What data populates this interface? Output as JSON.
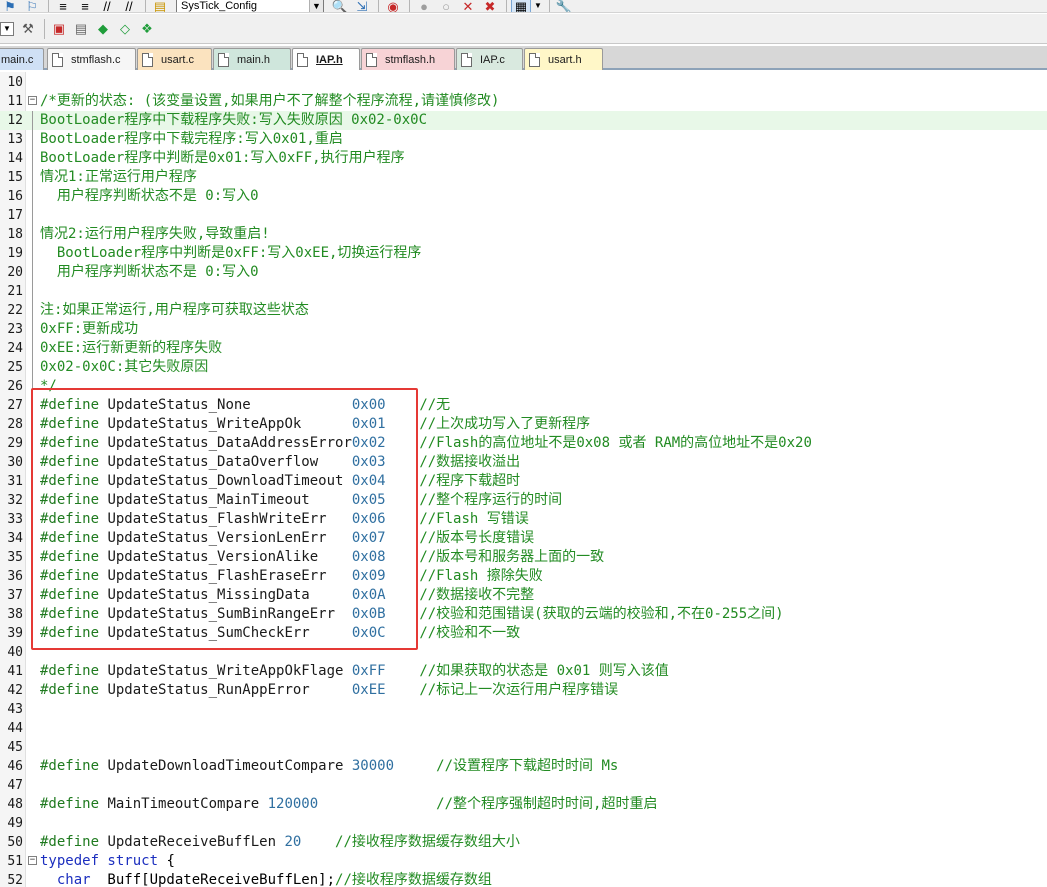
{
  "toolbar1": {
    "combo_value": "SysTick_Config"
  },
  "tabs": [
    {
      "label": "main.c",
      "color": "#cfe0f5",
      "active": false
    },
    {
      "label": "stmflash.c",
      "color": "#f6f6f6",
      "active": false
    },
    {
      "label": "usart.c",
      "color": "#fbe3bf",
      "active": false
    },
    {
      "label": "main.h",
      "color": "#cfe6dc",
      "active": false
    },
    {
      "label": "IAP.h",
      "color": "#ffffff",
      "active": true
    },
    {
      "label": "stmflash.h",
      "color": "#f7d3d6",
      "active": false
    },
    {
      "label": "IAP.c",
      "color": "#d9e9df",
      "active": false
    },
    {
      "label": "usart.h",
      "color": "#fff7c8",
      "active": false
    }
  ],
  "editor": {
    "lines": [
      {
        "num": "10",
        "fold": "",
        "segs": []
      },
      {
        "num": "11",
        "fold": "-",
        "segs": [
          {
            "t": "/*更新的状态: (该变量设置,如果用户不了解整个程序流程,请谨慎修改)",
            "c": "cm"
          }
        ]
      },
      {
        "num": "12",
        "fold": "",
        "hl": true,
        "segs": [
          {
            "t": "BootLoader程序中下载程序失败:写入失败原因 0x02-0x0C",
            "c": "cm"
          }
        ]
      },
      {
        "num": "13",
        "fold": "",
        "segs": [
          {
            "t": "BootLoader程序中下载完程序:写入0x01,重启",
            "c": "cm"
          }
        ]
      },
      {
        "num": "14",
        "fold": "",
        "segs": [
          {
            "t": "BootLoader程序中判断是0x01:写入0xFF,执行用户程序",
            "c": "cm"
          }
        ]
      },
      {
        "num": "15",
        "fold": "",
        "segs": [
          {
            "t": "情况1:正常运行用户程序",
            "c": "cm"
          }
        ]
      },
      {
        "num": "16",
        "fold": "",
        "segs": [
          {
            "t": "  用户程序判断状态不是 0:写入0",
            "c": "cm"
          }
        ]
      },
      {
        "num": "17",
        "fold": "",
        "segs": []
      },
      {
        "num": "18",
        "fold": "",
        "segs": [
          {
            "t": "情况2:运行用户程序失败,导致重启!",
            "c": "cm"
          }
        ]
      },
      {
        "num": "19",
        "fold": "",
        "segs": [
          {
            "t": "  BootLoader程序中判断是0xFF:写入0xEE,切换运行程序",
            "c": "cm"
          }
        ]
      },
      {
        "num": "20",
        "fold": "",
        "segs": [
          {
            "t": "  用户程序判断状态不是 0:写入0",
            "c": "cm"
          }
        ]
      },
      {
        "num": "21",
        "fold": "",
        "segs": []
      },
      {
        "num": "22",
        "fold": "",
        "segs": [
          {
            "t": "注:如果正常运行,用户程序可获取这些状态",
            "c": "cm"
          }
        ]
      },
      {
        "num": "23",
        "fold": "",
        "segs": [
          {
            "t": "0xFF:更新成功",
            "c": "cm"
          }
        ]
      },
      {
        "num": "24",
        "fold": "",
        "segs": [
          {
            "t": "0xEE:运行新更新的程序失败",
            "c": "cm"
          }
        ]
      },
      {
        "num": "25",
        "fold": "",
        "segs": [
          {
            "t": "0x02-0x0C:其它失败原因",
            "c": "cm"
          }
        ]
      },
      {
        "num": "26",
        "fold": "",
        "segs": [
          {
            "t": "*/",
            "c": "cm"
          }
        ]
      },
      {
        "num": "27",
        "fold": "",
        "segs": [
          {
            "t": "#define ",
            "c": "pp"
          },
          {
            "t": "UpdateStatus_None            ",
            "c": "id"
          },
          {
            "t": "0x00    ",
            "c": "num"
          },
          {
            "t": "//无",
            "c": "cm"
          }
        ]
      },
      {
        "num": "28",
        "fold": "",
        "segs": [
          {
            "t": "#define ",
            "c": "pp"
          },
          {
            "t": "UpdateStatus_WriteAppOk      ",
            "c": "id"
          },
          {
            "t": "0x01    ",
            "c": "num"
          },
          {
            "t": "//上次成功写入了更新程序",
            "c": "cm"
          }
        ]
      },
      {
        "num": "29",
        "fold": "",
        "segs": [
          {
            "t": "#define ",
            "c": "pp"
          },
          {
            "t": "UpdateStatus_DataAddressError",
            "c": "id"
          },
          {
            "t": "0x02    ",
            "c": "num"
          },
          {
            "t": "//Flash的高位地址不是0x08 或者 RAM的高位地址不是0x20",
            "c": "cm"
          }
        ]
      },
      {
        "num": "30",
        "fold": "",
        "segs": [
          {
            "t": "#define ",
            "c": "pp"
          },
          {
            "t": "UpdateStatus_DataOverflow    ",
            "c": "id"
          },
          {
            "t": "0x03    ",
            "c": "num"
          },
          {
            "t": "//数据接收溢出",
            "c": "cm"
          }
        ]
      },
      {
        "num": "31",
        "fold": "",
        "segs": [
          {
            "t": "#define ",
            "c": "pp"
          },
          {
            "t": "UpdateStatus_DownloadTimeout ",
            "c": "id"
          },
          {
            "t": "0x04    ",
            "c": "num"
          },
          {
            "t": "//程序下载超时",
            "c": "cm"
          }
        ]
      },
      {
        "num": "32",
        "fold": "",
        "segs": [
          {
            "t": "#define ",
            "c": "pp"
          },
          {
            "t": "UpdateStatus_MainTimeout     ",
            "c": "id"
          },
          {
            "t": "0x05    ",
            "c": "num"
          },
          {
            "t": "//整个程序运行的时间",
            "c": "cm"
          }
        ]
      },
      {
        "num": "33",
        "fold": "",
        "segs": [
          {
            "t": "#define ",
            "c": "pp"
          },
          {
            "t": "UpdateStatus_FlashWriteErr   ",
            "c": "id"
          },
          {
            "t": "0x06    ",
            "c": "num"
          },
          {
            "t": "//Flash 写错误",
            "c": "cm"
          }
        ]
      },
      {
        "num": "34",
        "fold": "",
        "segs": [
          {
            "t": "#define ",
            "c": "pp"
          },
          {
            "t": "UpdateStatus_VersionLenErr   ",
            "c": "id"
          },
          {
            "t": "0x07    ",
            "c": "num"
          },
          {
            "t": "//版本号长度错误",
            "c": "cm"
          }
        ]
      },
      {
        "num": "35",
        "fold": "",
        "segs": [
          {
            "t": "#define ",
            "c": "pp"
          },
          {
            "t": "UpdateStatus_VersionAlike    ",
            "c": "id"
          },
          {
            "t": "0x08    ",
            "c": "num"
          },
          {
            "t": "//版本号和服务器上面的一致",
            "c": "cm"
          }
        ]
      },
      {
        "num": "36",
        "fold": "",
        "segs": [
          {
            "t": "#define ",
            "c": "pp"
          },
          {
            "t": "UpdateStatus_FlashEraseErr   ",
            "c": "id"
          },
          {
            "t": "0x09    ",
            "c": "num"
          },
          {
            "t": "//Flash 擦除失败",
            "c": "cm"
          }
        ]
      },
      {
        "num": "37",
        "fold": "",
        "segs": [
          {
            "t": "#define ",
            "c": "pp"
          },
          {
            "t": "UpdateStatus_MissingData     ",
            "c": "id"
          },
          {
            "t": "0x0A    ",
            "c": "num"
          },
          {
            "t": "//数据接收不完整",
            "c": "cm"
          }
        ]
      },
      {
        "num": "38",
        "fold": "",
        "segs": [
          {
            "t": "#define ",
            "c": "pp"
          },
          {
            "t": "UpdateStatus_SumBinRangeErr  ",
            "c": "id"
          },
          {
            "t": "0x0B    ",
            "c": "num"
          },
          {
            "t": "//校验和范围错误(获取的云端的校验和,不在0-255之间)",
            "c": "cm"
          }
        ]
      },
      {
        "num": "39",
        "fold": "",
        "segs": [
          {
            "t": "#define ",
            "c": "pp"
          },
          {
            "t": "UpdateStatus_SumCheckErr     ",
            "c": "id"
          },
          {
            "t": "0x0C    ",
            "c": "num"
          },
          {
            "t": "//校验和不一致",
            "c": "cm"
          }
        ]
      },
      {
        "num": "40",
        "fold": "",
        "segs": []
      },
      {
        "num": "41",
        "fold": "",
        "segs": [
          {
            "t": "#define ",
            "c": "pp"
          },
          {
            "t": "UpdateStatus_WriteAppOkFlage ",
            "c": "id"
          },
          {
            "t": "0xFF    ",
            "c": "num"
          },
          {
            "t": "//如果获取的状态是 0x01 则写入该值",
            "c": "cm"
          }
        ]
      },
      {
        "num": "42",
        "fold": "",
        "segs": [
          {
            "t": "#define ",
            "c": "pp"
          },
          {
            "t": "UpdateStatus_RunAppError     ",
            "c": "id"
          },
          {
            "t": "0xEE    ",
            "c": "num"
          },
          {
            "t": "//标记上一次运行用户程序错误",
            "c": "cm"
          }
        ]
      },
      {
        "num": "43",
        "fold": "",
        "segs": []
      },
      {
        "num": "44",
        "fold": "",
        "segs": []
      },
      {
        "num": "45",
        "fold": "",
        "segs": []
      },
      {
        "num": "46",
        "fold": "",
        "segs": [
          {
            "t": "#define ",
            "c": "pp"
          },
          {
            "t": "UpdateDownloadTimeoutCompare ",
            "c": "id"
          },
          {
            "t": "30000     ",
            "c": "num"
          },
          {
            "t": "//设置程序下载超时时间 Ms",
            "c": "cm"
          }
        ]
      },
      {
        "num": "47",
        "fold": "",
        "segs": []
      },
      {
        "num": "48",
        "fold": "",
        "segs": [
          {
            "t": "#define ",
            "c": "pp"
          },
          {
            "t": "MainTimeoutCompare ",
            "c": "id"
          },
          {
            "t": "120000              ",
            "c": "num"
          },
          {
            "t": "//整个程序强制超时时间,超时重启",
            "c": "cm"
          }
        ]
      },
      {
        "num": "49",
        "fold": "",
        "segs": []
      },
      {
        "num": "50",
        "fold": "",
        "segs": [
          {
            "t": "#define ",
            "c": "pp"
          },
          {
            "t": "UpdateReceiveBuffLen ",
            "c": "id"
          },
          {
            "t": "20    ",
            "c": "num"
          },
          {
            "t": "//接收程序数据缓存数组大小",
            "c": "cm"
          }
        ]
      },
      {
        "num": "51",
        "fold": "-",
        "segs": [
          {
            "t": "typedef struct",
            "c": "kw"
          },
          {
            "t": " {",
            "c": "plain"
          }
        ]
      },
      {
        "num": "52",
        "fold": "",
        "segs": [
          {
            "t": "  ",
            "c": "plain"
          },
          {
            "t": "char",
            "c": "kw"
          },
          {
            "t": "  Buff[UpdateReceiveBuffLen];",
            "c": "plain"
          },
          {
            "t": "//接收程序数据缓存数组",
            "c": "cm"
          }
        ]
      }
    ]
  }
}
